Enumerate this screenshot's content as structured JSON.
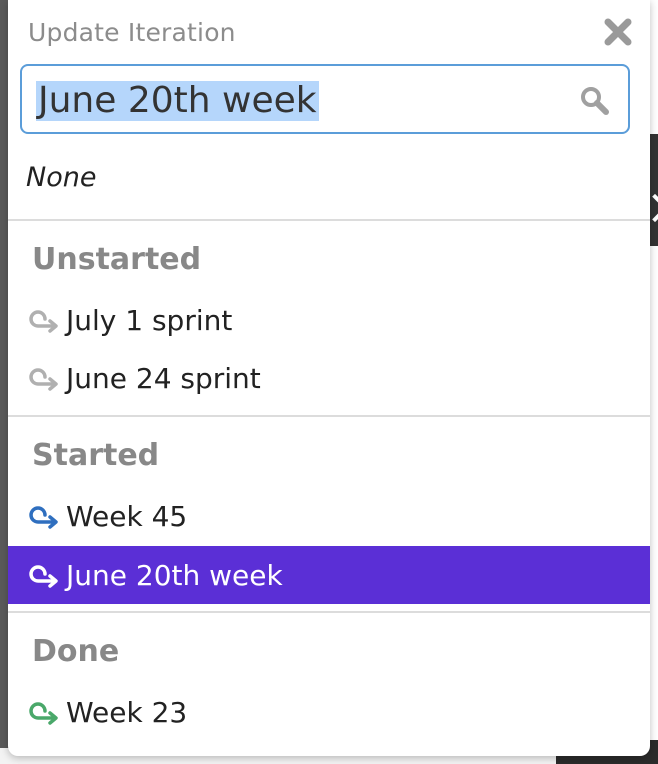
{
  "popover": {
    "title": "Update Iteration",
    "close_icon": "close-icon",
    "search": {
      "value": "June 20th week",
      "icon": "search-icon"
    },
    "none_label": "None"
  },
  "groups": [
    {
      "heading": "Unstarted",
      "items": [
        {
          "label": "July 1 sprint",
          "status": "unstarted"
        },
        {
          "label": "June 24 sprint",
          "status": "unstarted"
        }
      ]
    },
    {
      "heading": "Started",
      "items": [
        {
          "label": "Week 45",
          "status": "started"
        },
        {
          "label": "June 20th week",
          "status": "started",
          "selected": true
        }
      ]
    },
    {
      "heading": "Done",
      "items": [
        {
          "label": "Week 23",
          "status": "done"
        }
      ]
    }
  ],
  "colors": {
    "unstarted": "#b0b0b0",
    "started": "#2f6fbf",
    "done": "#4aa86a",
    "selected_bg": "#5b2fd6",
    "focus_border": "#5b9dd9",
    "text_selection": "#b5d6fb"
  }
}
